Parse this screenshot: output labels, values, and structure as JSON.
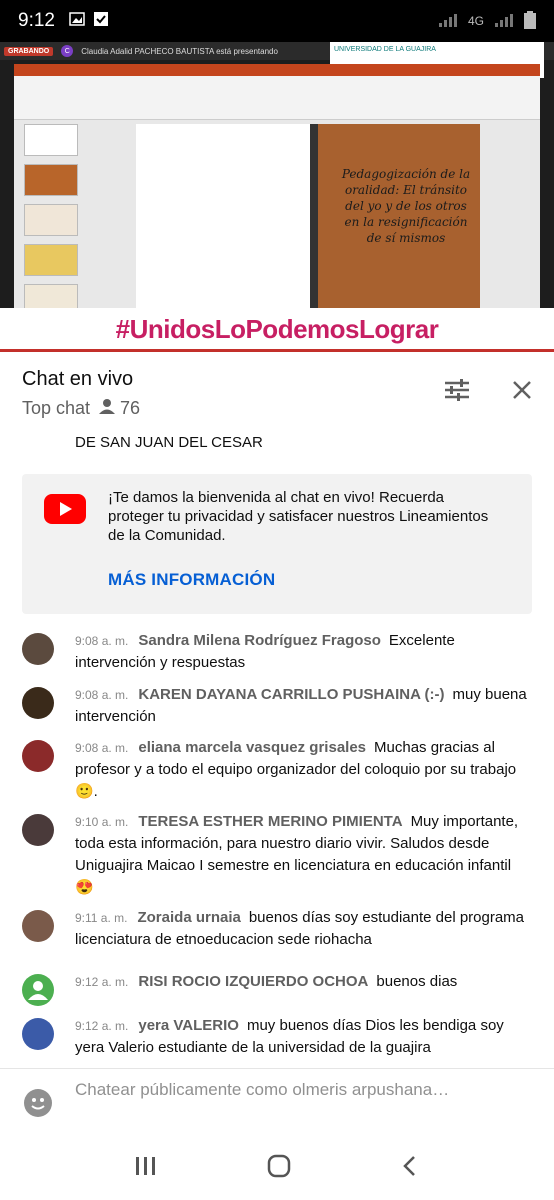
{
  "status_bar": {
    "time": "9:12",
    "network": "4G"
  },
  "video": {
    "recording_label": "GRABANDO",
    "presenter_initial": "C",
    "presenter_text": "Claudia Adalid PACHECO BAUTISTA está presentando",
    "slide_text": "Pedagogización de la oralidad: El tránsito del yo y de los otros en la resignificación de sí mismos",
    "banner_text": "#UnidosLoPodemosLograr",
    "logo_text": "UNIVERSIDAD DE LA GUAJIRA"
  },
  "chat_header": {
    "title": "Chat en vivo",
    "mode": "Top chat",
    "viewer_count": "76"
  },
  "chat": {
    "previous_line": "DE SAN JUAN DEL CESAR",
    "welcome_text": "¡Te damos la bienvenida al chat en vivo! Recuerda proteger tu privacidad y satisfacer nuestros Lineamientos de la Comunidad.",
    "more_info": "MÁS INFORMACIÓN",
    "messages": [
      {
        "time": "9:08 a. m.",
        "author": "Sandra Milena Rodríguez Fragoso",
        "text": "Excelente intervención y respuestas",
        "avatar_color": "#5b4a3e"
      },
      {
        "time": "9:08 a. m.",
        "author": "KAREN DAYANA CARRILLO PUSHAINA (:-)",
        "text": "muy buena intervención",
        "avatar_color": "#3a2a1a"
      },
      {
        "time": "9:08 a. m.",
        "author": "eliana marcela vasquez grisales",
        "text": "Muchas gracias al profesor y a todo el equipo organizador del coloquio por su trabajo 🙂.",
        "avatar_color": "#8b2a2a"
      },
      {
        "time": "9:10 a. m.",
        "author": "TERESA ESTHER MERINO PIMIENTA",
        "text": "Muy importante, toda esta información, para nuestro diario vivir. Saludos desde Uniguajira Maicao I semestre en licenciatura en educación infantil 😍",
        "avatar_color": "#4a3a3a"
      },
      {
        "time": "9:11 a. m.",
        "author": "Zoraida urnaia",
        "text": "buenos días soy estudiante del programa licenciatura de etnoeducacion sede riohacha",
        "avatar_color": "#7a5a4a"
      },
      {
        "time": "9:12 a. m.",
        "author": "RISI ROCIO IZQUIERDO OCHOA",
        "text": "buenos dias",
        "avatar_color": "#4caf50"
      },
      {
        "time": "9:12 a. m.",
        "author": "yera VALERIO",
        "text": "muy buenos días Dios les bendiga soy yera Valerio estudiante de la universidad de la guajira",
        "avatar_color": "#3b5ba8"
      }
    ]
  },
  "input": {
    "placeholder": "Chatear públicamente como olmeris arpushana…"
  }
}
